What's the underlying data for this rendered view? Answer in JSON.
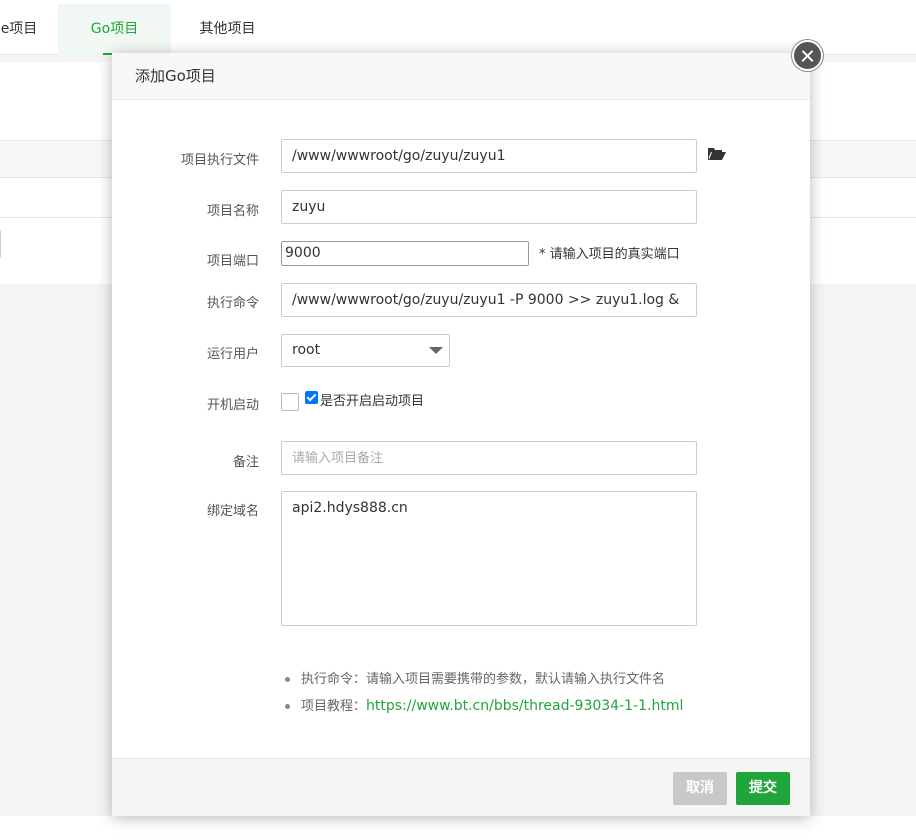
{
  "tabs": [
    {
      "label": "e项目"
    },
    {
      "label": "Go项目"
    },
    {
      "label": "其他项目"
    }
  ],
  "modal": {
    "title": "添加Go项目",
    "fields": {
      "exec_file": {
        "label": "项目执行文件",
        "value": "/www/wwwroot/go/zuyu/zuyu1"
      },
      "name": {
        "label": "项目名称",
        "value": "zuyu"
      },
      "port": {
        "label": "项目端口",
        "value": "9000",
        "hint": "* 请输入项目的真实端口"
      },
      "command": {
        "label": "执行命令",
        "value": "/www/wwwroot/go/zuyu/zuyu1 -P 9000 >> zuyu1.log &"
      },
      "run_user": {
        "label": "运行用户",
        "value": "root"
      },
      "boot": {
        "label": "开机启动",
        "checkbox_label": "是否开启启动项目"
      },
      "remark": {
        "label": "备注",
        "placeholder": "请输入项目备注"
      },
      "domain": {
        "label": "绑定域名",
        "value": "api2.hdys888.cn"
      }
    },
    "notes": [
      {
        "text": "执行命令：请输入项目需要携带的参数，默认请输入执行文件名"
      },
      {
        "prefix": "项目教程：",
        "link": "https://www.bt.cn/bbs/thread-93034-1-1.html"
      }
    ],
    "buttons": {
      "cancel": "取消",
      "submit": "提交"
    }
  },
  "icons": {
    "folder": "folder-open-icon",
    "close": "close-icon",
    "dropdown": "chevron-down-icon"
  },
  "colors": {
    "accent": "#20a53a",
    "cancel": "#c8c8c8"
  }
}
